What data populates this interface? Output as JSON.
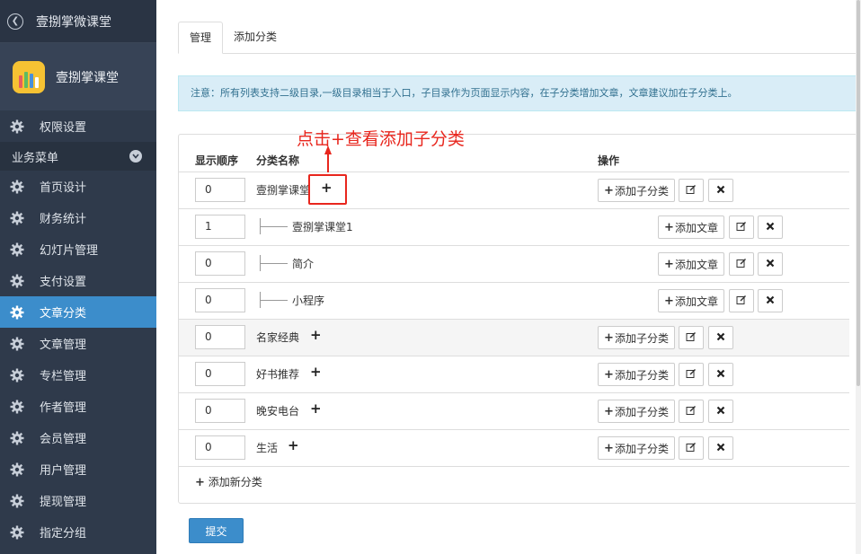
{
  "sidebar": {
    "back_title": "壹捌掌微课堂",
    "brand_name": "壹捌掌课堂",
    "perm_item": "权限设置",
    "section_label": "业务菜单",
    "items": [
      {
        "label": "首页设计",
        "icon": "gear-icon"
      },
      {
        "label": "财务统计",
        "icon": "gear-icon"
      },
      {
        "label": "幻灯片管理",
        "icon": "gear-icon"
      },
      {
        "label": "支付设置",
        "icon": "gear-icon"
      },
      {
        "label": "文章分类",
        "icon": "gear-icon",
        "active": true
      },
      {
        "label": "文章管理",
        "icon": "gear-icon"
      },
      {
        "label": "专栏管理",
        "icon": "gear-icon"
      },
      {
        "label": "作者管理",
        "icon": "gear-icon"
      },
      {
        "label": "会员管理",
        "icon": "gear-icon"
      },
      {
        "label": "用户管理",
        "icon": "gear-icon"
      },
      {
        "label": "提现管理",
        "icon": "gear-icon"
      },
      {
        "label": "指定分组",
        "icon": "gear-icon"
      }
    ]
  },
  "tabs": [
    "管理",
    "添加分类"
  ],
  "notice": "注意：所有列表支持二级目录,一级目录相当于入口，子目录作为页面显示内容，在子分类增加文章，文章建议加在子分类上。",
  "table": {
    "headers": {
      "order": "显示顺序",
      "name": "分类名称",
      "ops": "操作"
    },
    "rows": [
      {
        "order": "0",
        "name": "壹捌掌课堂",
        "level": 1,
        "action": "添加子分类"
      },
      {
        "order": "1",
        "name": "壹捌掌课堂1",
        "level": 2,
        "action": "添加文章"
      },
      {
        "order": "0",
        "name": "简介",
        "level": 2,
        "action": "添加文章"
      },
      {
        "order": "0",
        "name": "小程序",
        "level": 2,
        "action": "添加文章"
      },
      {
        "order": "0",
        "name": "名家经典",
        "level": 1,
        "action": "添加子分类"
      },
      {
        "order": "0",
        "name": "好书推荐",
        "level": 1,
        "action": "添加子分类"
      },
      {
        "order": "0",
        "name": "晚安电台",
        "level": 1,
        "action": "添加子分类"
      },
      {
        "order": "0",
        "name": "生活",
        "level": 1,
        "action": "添加子分类"
      }
    ],
    "add_category": "添加新分类"
  },
  "submit_label": "提交",
  "annotation": "点击+查看添加子分类",
  "colors": {
    "sidebar_bg": "#2f3a4b",
    "accent": "#3c8dcb",
    "annotation_red": "#e8261d",
    "notice_bg": "#d9edf7"
  }
}
